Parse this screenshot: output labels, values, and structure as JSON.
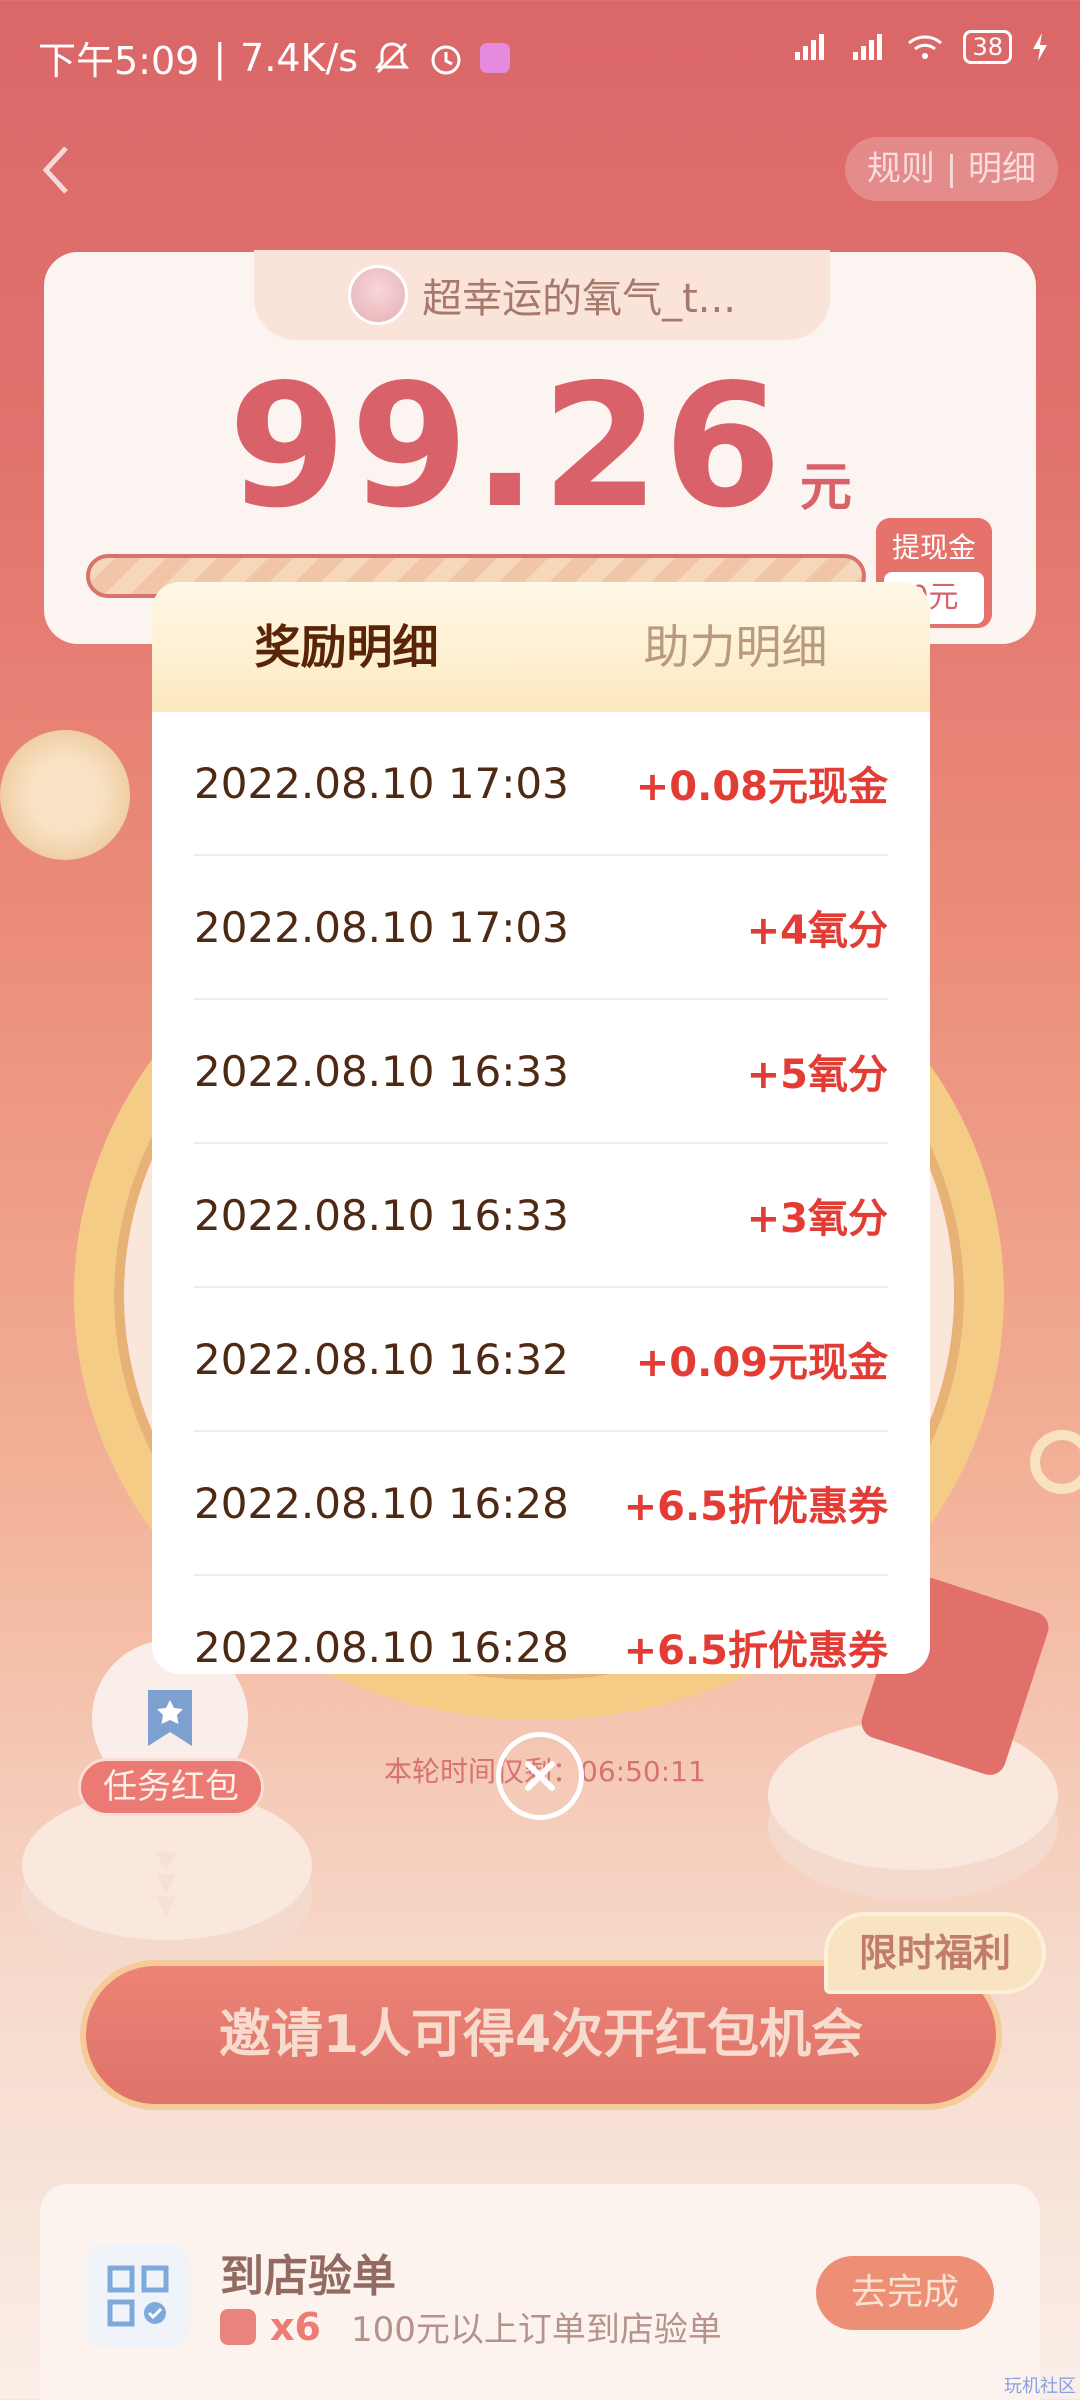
{
  "status_bar": {
    "time": "下午5:09",
    "speed": "7.4K/s",
    "battery": "38",
    "icons": [
      "mute-icon",
      "alarm-icon",
      "signal-icon",
      "hd-signal-icon",
      "wifi-icon",
      "charging-icon"
    ]
  },
  "header": {
    "rules_label": "规则 | 明细"
  },
  "balance": {
    "username": "超幸运的氧气_t...",
    "amount": "99.26",
    "unit": "元",
    "withdraw_label": "提现金",
    "withdraw_value": "0元"
  },
  "modal": {
    "tabs": [
      {
        "label": "奖励明细",
        "active": true
      },
      {
        "label": "助力明细",
        "active": false
      }
    ],
    "records": [
      {
        "time": "2022.08.10 17:03",
        "reward": "+0.08元现金"
      },
      {
        "time": "2022.08.10 17:03",
        "reward": "+4氧分"
      },
      {
        "time": "2022.08.10 16:33",
        "reward": "+5氧分"
      },
      {
        "time": "2022.08.10 16:33",
        "reward": "+3氧分"
      },
      {
        "time": "2022.08.10 16:32",
        "reward": "+0.09元现金"
      },
      {
        "time": "2022.08.10 16:28",
        "reward": "+6.5折优惠券"
      },
      {
        "time": "2022.08.10 16:28",
        "reward": "+6.5折优惠券"
      }
    ]
  },
  "background": {
    "task_packet_label": "任务红包",
    "round_time": "本轮时间仅剩：06:50:11",
    "invite_label": "邀请1人可得4次开红包机会",
    "limited_label": "限时福利",
    "task": {
      "title": "到店验单",
      "count": "x6",
      "description": "100元以上订单到店验单",
      "button": "去完成"
    },
    "corner_mark": "玩机社区"
  },
  "colors": {
    "brand_red": "#c5101c",
    "reward_red": "#e23c34",
    "tab_active": "#5a2407",
    "tab_inactive": "#b99a7e"
  }
}
